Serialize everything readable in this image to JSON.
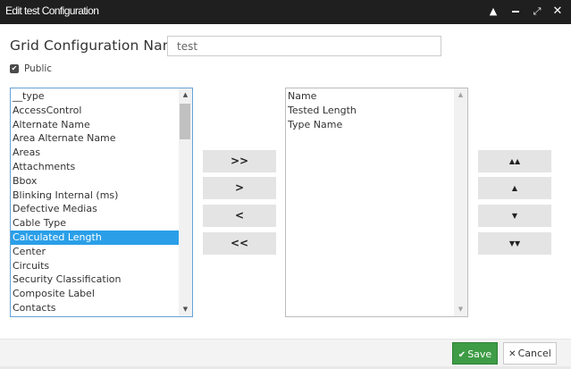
{
  "dialog": {
    "title": "Edit test Configuration",
    "icons": {
      "collapse": "chevron-up-icon",
      "minimize": "minimize-icon",
      "maximize": "fullscreen-icon",
      "close": "close-icon"
    }
  },
  "form": {
    "name_label": "Grid Configuration Name",
    "name_value": "test",
    "public_checked": true,
    "public_label": "Public"
  },
  "available_fields": {
    "items": [
      "__type",
      "AccessControl",
      "Alternate Name",
      "Area Alternate Name",
      "Areas",
      "Attachments",
      "Bbox",
      "Blinking Internal (ms)",
      "Defective Medias",
      "Cable Type",
      "Calculated Length",
      "Center",
      "Circuits",
      "Security Classification",
      "Composite Label",
      "Contacts"
    ],
    "selected": "Calculated Length"
  },
  "selected_fields": {
    "items": [
      "Name",
      "Tested Length",
      "Type Name"
    ]
  },
  "transfer_buttons": [
    {
      "label": ">>",
      "name": "add-all-button"
    },
    {
      "label": ">",
      "name": "add-selected-button"
    },
    {
      "label": "<",
      "name": "remove-selected-button"
    },
    {
      "label": "<<",
      "name": "remove-all-button"
    }
  ],
  "order_buttons": [
    {
      "icon": "move-to-top-icon",
      "name": "move-top-button"
    },
    {
      "icon": "move-up-icon",
      "name": "move-up-button"
    },
    {
      "icon": "move-down-icon",
      "name": "move-down-button"
    },
    {
      "icon": "move-to-bottom-icon",
      "name": "move-bottom-button"
    }
  ],
  "footer": {
    "save_label": "Save",
    "cancel_label": "Cancel"
  },
  "colors": {
    "titlebar": "#1f1f1f",
    "selection": "#2a9fe8",
    "save_button": "#3d9c45",
    "focus_border": "#66a3d6"
  }
}
